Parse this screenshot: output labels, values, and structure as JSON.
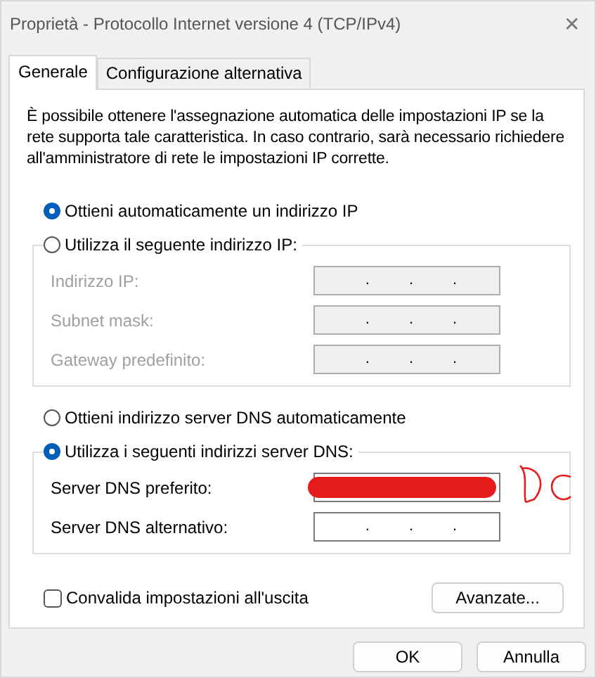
{
  "window": {
    "title": "Proprietà - Protocollo Internet versione 4 (TCP/IPv4)",
    "close": "✕"
  },
  "tabs": [
    {
      "label": "Generale",
      "selected": true
    },
    {
      "label": "Configurazione alternativa",
      "selected": false
    }
  ],
  "description": "È possibile ottenere l'assegnazione automatica delle impostazioni IP se la rete supporta tale caratteristica. In caso contrario, sarà necessario richiedere all'amministratore di rete le impostazioni IP corrette.",
  "ip": {
    "options": [
      {
        "label": "Ottieni automaticamente un indirizzo IP",
        "selected": true
      },
      {
        "label": "Utilizza il seguente indirizzo IP:",
        "selected": false
      }
    ],
    "fields": [
      {
        "label": "Indirizzo IP:",
        "disabled": true,
        "redacted": false
      },
      {
        "label": "Subnet mask:",
        "disabled": true,
        "redacted": false
      },
      {
        "label": "Gateway predefinito:",
        "disabled": true,
        "redacted": false
      }
    ]
  },
  "dns": {
    "options": [
      {
        "label": "Ottieni indirizzo server DNS automaticamente",
        "selected": false
      },
      {
        "label": "Utilizza i seguenti indirizzi server DNS:",
        "selected": true
      }
    ],
    "fields": [
      {
        "label": "Server DNS preferito:",
        "disabled": false,
        "redacted": true
      },
      {
        "label": "Server DNS alternativo:",
        "disabled": false,
        "redacted": false
      }
    ]
  },
  "separator": ".",
  "validate": {
    "label": "Convalida impostazioni all'uscita",
    "checked": false
  },
  "advanced_button": "Avanzate...",
  "buttons": [
    "OK",
    "Annulla"
  ]
}
